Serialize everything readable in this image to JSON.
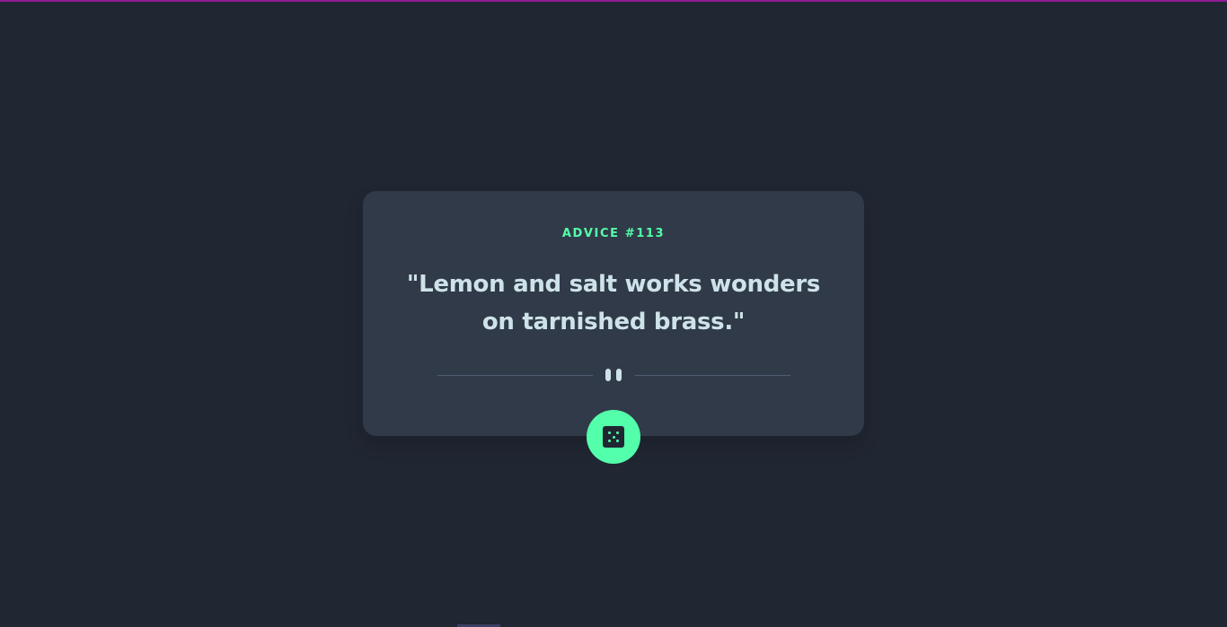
{
  "advice": {
    "id_label": "ADVICE #113",
    "quote": "\"Lemon and salt works wonders on tarnished brass.\""
  },
  "icons": {
    "divider": "pause-icon",
    "button": "dice-icon"
  },
  "colors": {
    "background": "#202632",
    "card": "#313a48",
    "accent": "#53ffaa",
    "text": "#cee3e9",
    "divider": "#4f5d74",
    "top_line": "#8e1b93"
  }
}
